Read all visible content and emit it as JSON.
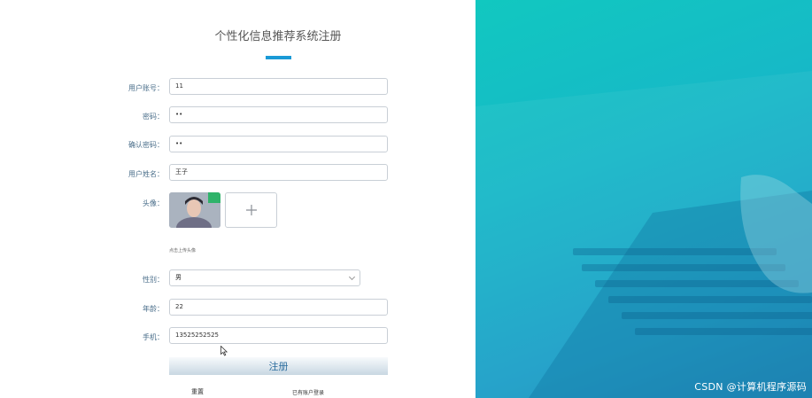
{
  "form": {
    "title": "个性化信息推荐系统注册",
    "fields": {
      "account": {
        "label": "用户账号：",
        "value": "11"
      },
      "password": {
        "label": "密码：",
        "value": "••"
      },
      "confirm": {
        "label": "确认密码：",
        "value": "••"
      },
      "name": {
        "label": "用户姓名：",
        "value": "王子"
      },
      "avatar": {
        "label": "头像：",
        "hint": "点击上传头像"
      },
      "gender": {
        "label": "性别：",
        "value": "男"
      },
      "age": {
        "label": "年龄：",
        "value": "22"
      },
      "phone": {
        "label": "手机：",
        "value": "13525252525"
      }
    },
    "submit_label": "注册",
    "reset_label": "重置",
    "login_link": "已有账户登录"
  },
  "watermark": "CSDN @计算机程序源码",
  "colors": {
    "accent": "#1a9ad6",
    "panel": "#17b7c8",
    "button_text": "#2f6f9f"
  },
  "icons": {
    "upload": "plus-icon",
    "select": "chevron-down-icon",
    "cursor": "mouse-pointer-icon"
  }
}
